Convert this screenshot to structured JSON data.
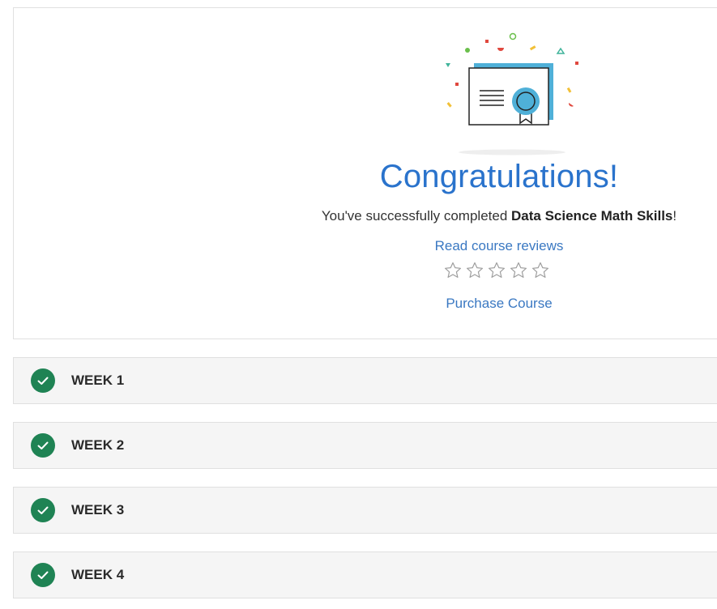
{
  "completion": {
    "heading": "Congratulations!",
    "message_prefix": "You've successfully completed ",
    "course_name": "Data Science Math Skills",
    "message_suffix": "!",
    "read_reviews_link": "Read course reviews",
    "purchase_link": "Purchase Course",
    "rating": {
      "filled": 0,
      "max": 5
    }
  },
  "weeks": [
    {
      "label": "WEEK 1",
      "completed": true
    },
    {
      "label": "WEEK 2",
      "completed": true
    },
    {
      "label": "WEEK 3",
      "completed": true
    },
    {
      "label": "WEEK 4",
      "completed": true
    }
  ],
  "colors": {
    "heading": "#2a73cc",
    "link": "#3a78c2",
    "check": "#1f8354",
    "row_bg": "#f5f5f5"
  },
  "icons": [
    "certificate-icon",
    "star-outline-icon",
    "check-circle-icon"
  ]
}
